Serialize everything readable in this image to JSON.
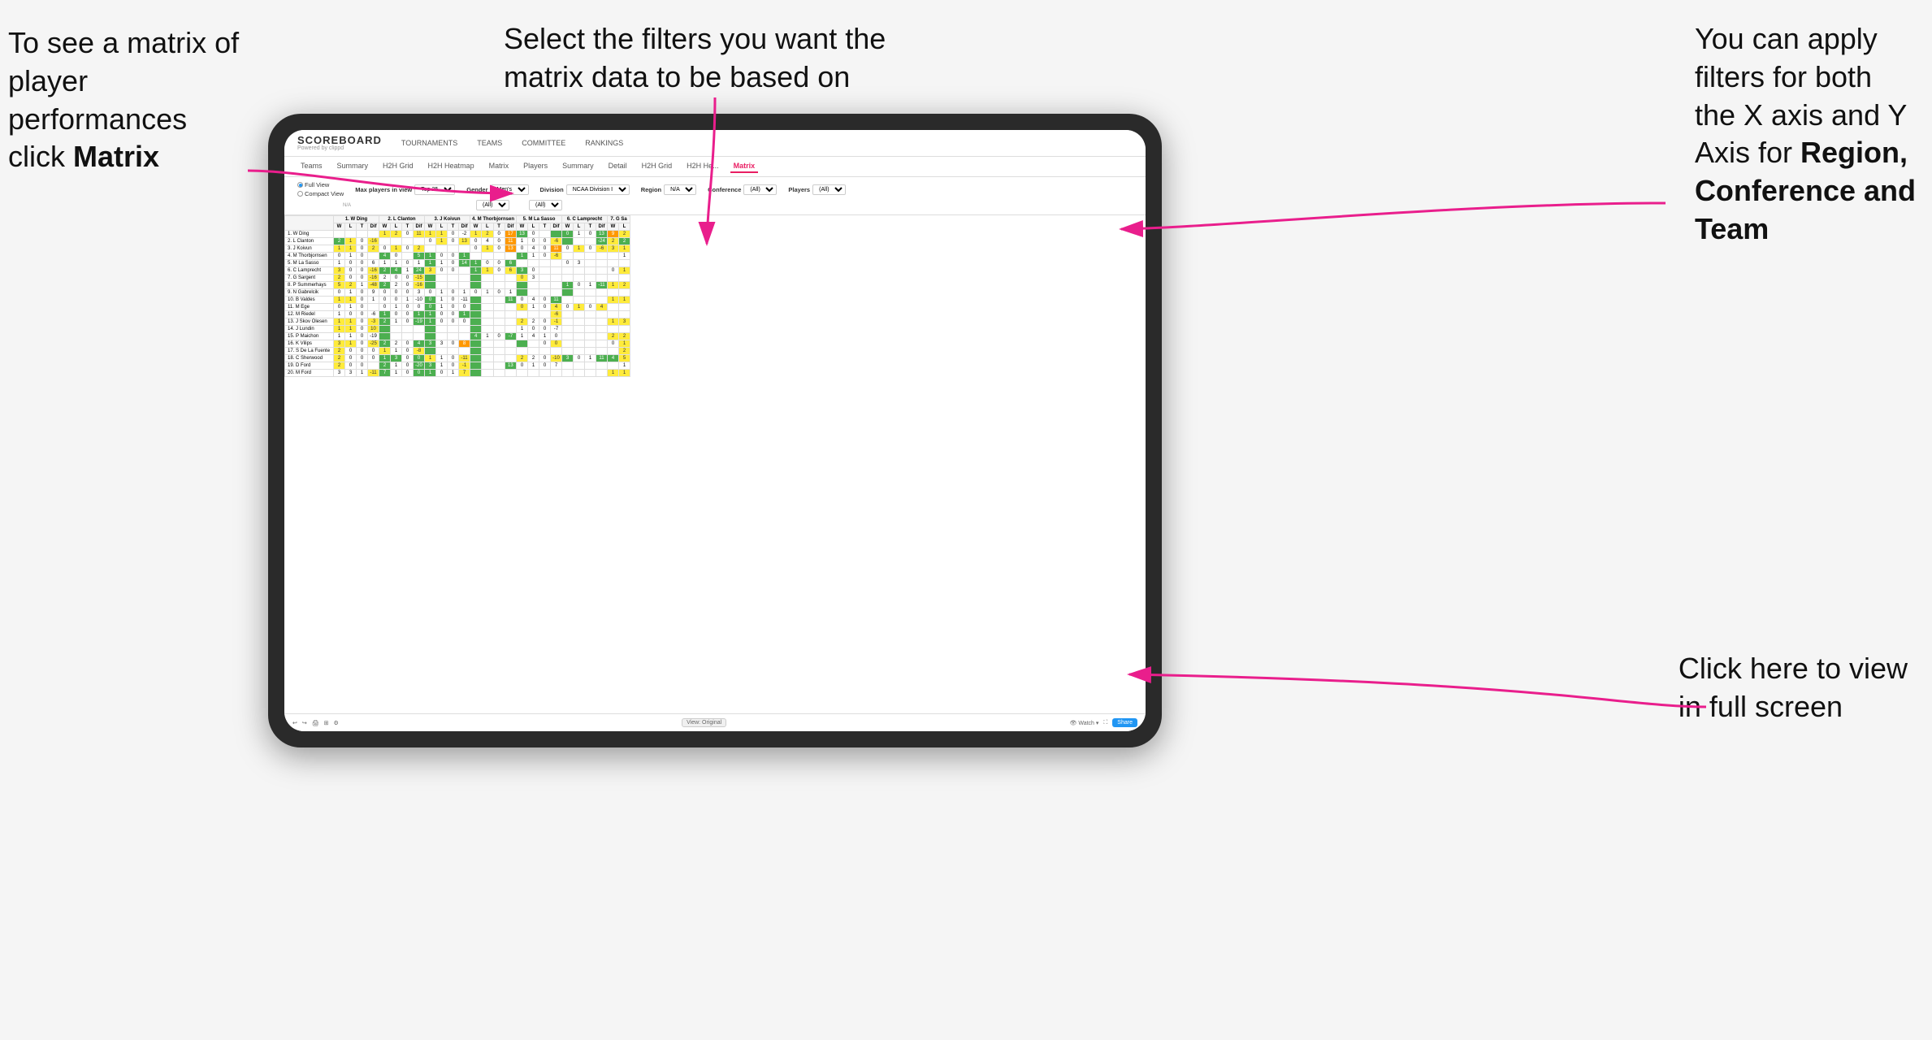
{
  "annotations": {
    "top_left": {
      "line1": "To see a matrix of",
      "line2": "player performances",
      "line3_prefix": "click ",
      "line3_bold": "Matrix"
    },
    "top_center": {
      "line1": "Select the filters you want the",
      "line2": "matrix data to be based on"
    },
    "top_right": {
      "line1": "You  can apply",
      "line2": "filters for both",
      "line3": "the X axis and Y",
      "line4_prefix": "Axis for ",
      "line4_bold": "Region,",
      "line5_bold": "Conference and",
      "line6_bold": "Team"
    },
    "bottom_right": {
      "line1": "Click here to view",
      "line2": "in full screen"
    }
  },
  "header": {
    "logo": "SCOREBOARD",
    "logo_sub": "Powered by clippd",
    "nav_items": [
      "TOURNAMENTS",
      "TEAMS",
      "COMMITTEE",
      "RANKINGS"
    ]
  },
  "sub_nav": {
    "items": [
      "Teams",
      "Summary",
      "H2H Grid",
      "H2H Heatmap",
      "Matrix",
      "Players",
      "Summary",
      "Detail",
      "H2H Grid",
      "H2H He...",
      "Matrix"
    ]
  },
  "filters": {
    "view_options": [
      "Full View",
      "Compact View"
    ],
    "selected_view": "Full View",
    "max_players_label": "Max players in view",
    "max_players_value": "Top 25",
    "gender_label": "Gender",
    "gender_value": "Men's",
    "division_label": "Division",
    "division_value": "NCAA Division I",
    "region_label": "Region",
    "region_value": "N/A",
    "conference_label": "Conference",
    "conference_value": "(All)",
    "players_label": "Players",
    "players_value": "(All)"
  },
  "column_headers": [
    "1. W Ding",
    "2. L Clanton",
    "3. J Koivun",
    "4. M Thorbjornsen",
    "5. M La Sasso",
    "6. C Lamprecht",
    "7. G Sa"
  ],
  "sub_col_headers": [
    "W",
    "L",
    "T",
    "Dif"
  ],
  "rows": [
    {
      "name": "1. W Ding",
      "cells": []
    },
    {
      "name": "2. L Clanton",
      "cells": []
    },
    {
      "name": "3. J Koivun",
      "cells": []
    },
    {
      "name": "4. M Thorbjornsen",
      "cells": []
    },
    {
      "name": "5. M La Sasso",
      "cells": []
    },
    {
      "name": "6. C Lamprecht",
      "cells": []
    },
    {
      "name": "7. G Sargent",
      "cells": []
    },
    {
      "name": "8. P Summerhays",
      "cells": []
    },
    {
      "name": "9. N Gabrelcik",
      "cells": []
    },
    {
      "name": "10. B Valdes",
      "cells": []
    },
    {
      "name": "11. M Ege",
      "cells": []
    },
    {
      "name": "12. M Riedel",
      "cells": []
    },
    {
      "name": "13. J Skov Olesen",
      "cells": []
    },
    {
      "name": "14. J Lundin",
      "cells": []
    },
    {
      "name": "15. P Maichon",
      "cells": []
    },
    {
      "name": "16. K Vilips",
      "cells": []
    },
    {
      "name": "17. S De La Fuente",
      "cells": []
    },
    {
      "name": "18. C Sherwood",
      "cells": []
    },
    {
      "name": "19. D Ford",
      "cells": []
    },
    {
      "name": "20. M Ford",
      "cells": []
    }
  ],
  "bottom_bar": {
    "view_original": "View: Original",
    "watch": "Watch",
    "share": "Share"
  }
}
